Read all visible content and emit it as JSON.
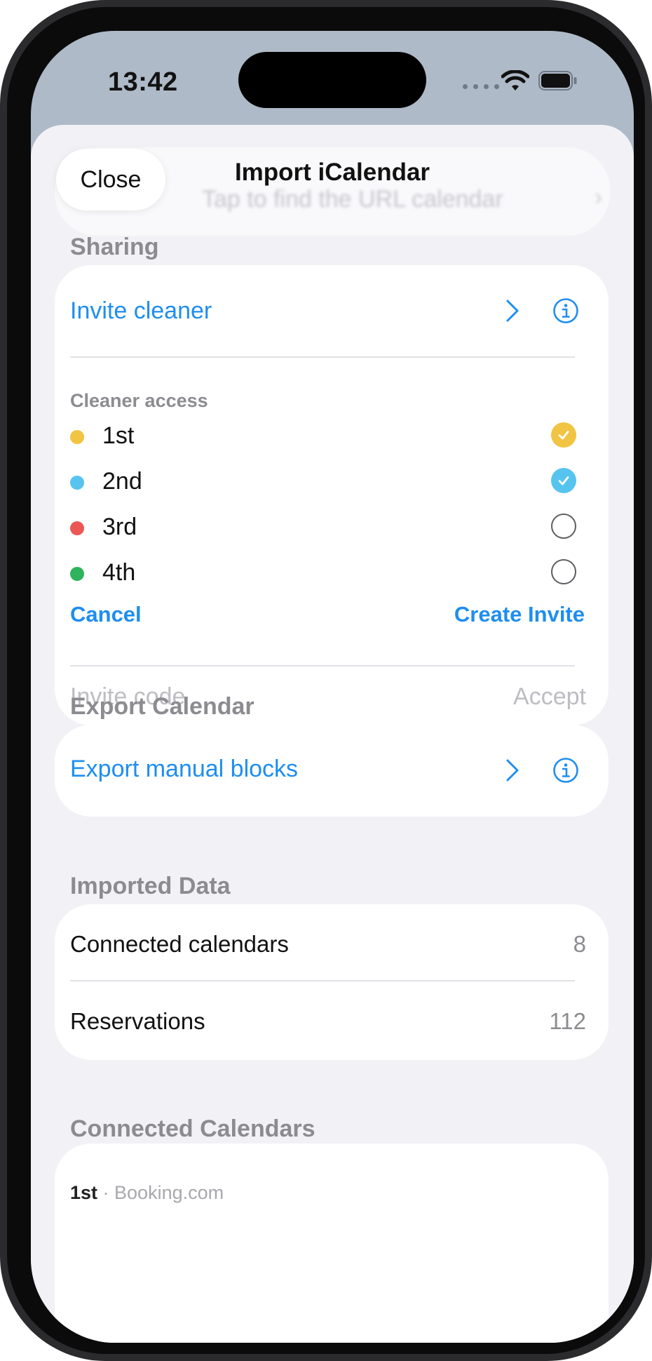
{
  "status_bar": {
    "time": "13:42"
  },
  "nav": {
    "close_label": "Close",
    "title": "Import iCalendar",
    "background_ghost_text": "Tap to find the URL calendar"
  },
  "sharing": {
    "header": "Sharing",
    "invite_cleaner_label": "Invite cleaner",
    "cleaner_access_label": "Cleaner access",
    "shifts": [
      {
        "label": "1st",
        "color": "#f2c443",
        "checked": true
      },
      {
        "label": "2nd",
        "color": "#56c4ef",
        "checked": true
      },
      {
        "label": "3rd",
        "color": "#eb5756",
        "checked": false
      },
      {
        "label": "4th",
        "color": "#2fb35c",
        "checked": false
      }
    ],
    "cancel_label": "Cancel",
    "create_invite_label": "Create Invite",
    "invite_code_placeholder": "Invite code",
    "accept_label": "Accept"
  },
  "export": {
    "header": "Export Calendar",
    "export_manual_blocks_label": "Export manual blocks"
  },
  "imported": {
    "header": "Imported Data",
    "rows": [
      {
        "label": "Connected calendars",
        "value": "8"
      },
      {
        "label": "Reservations",
        "value": "112"
      }
    ]
  },
  "connected": {
    "header": "Connected Calendars",
    "first_item_name": "1st",
    "first_item_source": " · Booking.com"
  },
  "colors": {
    "accent": "#1e8ef0",
    "background": "#f1f1f6",
    "card": "#ffffff"
  },
  "icons": {
    "chevron": "chevron-right-icon",
    "info": "info-circle-icon",
    "check": "checkmark-icon"
  }
}
